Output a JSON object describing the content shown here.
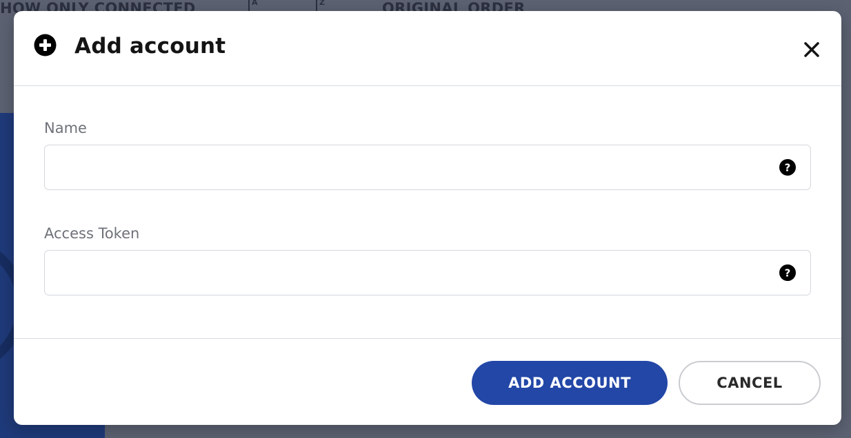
{
  "background": {
    "filter_label": "HOW ONLY CONNECTED",
    "sort_az_letters": "A",
    "sort_za_letters": "Z",
    "order_label": "ORIGINAL ORDER"
  },
  "modal": {
    "title": "Add account",
    "header_icon": "plus-circle-icon",
    "close_icon": "close-icon",
    "fields": [
      {
        "label": "Name",
        "value": "",
        "placeholder": "",
        "help_icon": "help-icon"
      },
      {
        "label": "Access Token",
        "value": "",
        "placeholder": "",
        "help_icon": "help-icon"
      }
    ],
    "buttons": {
      "primary": "ADD ACCOUNT",
      "secondary": "CANCEL"
    }
  },
  "colors": {
    "primary_button": "#2347a7",
    "overlay": "#5c6272",
    "bg_panel": "#1f3a7a"
  }
}
